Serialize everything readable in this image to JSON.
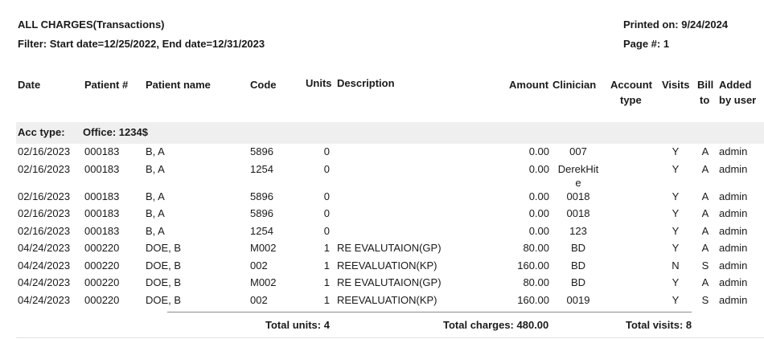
{
  "report": {
    "title": "ALL CHARGES(Transactions)",
    "filter": "Filter: Start date=12/25/2022, End date=12/31/2023",
    "printed_on": "Printed on: 9/24/2024",
    "page": "Page #: 1"
  },
  "columns": {
    "date": "Date",
    "patient_num": "Patient #",
    "patient_name": "Patient name",
    "code": "Code",
    "units": "Units",
    "description": "Description",
    "amount": "Amount",
    "clinician": "Clinician",
    "account_type_1": "Account",
    "account_type_2": "type",
    "visits": "Visits",
    "bill_to_1": "Bill",
    "bill_to_2": "to",
    "added_by_1": "Added",
    "added_by_2": "by user"
  },
  "group": {
    "acc_type_label": "Acc type:",
    "acc_type_value": "Office: 1234$"
  },
  "rows": [
    {
      "date": "02/16/2023",
      "patient_num": "000183",
      "patient_name": "B, A",
      "code": "5896",
      "units": "0",
      "description": "",
      "amount": "0.00",
      "clinician": "007",
      "clinician2": "",
      "visits": "Y",
      "bill_to": "A",
      "added_by": "admin"
    },
    {
      "date": "02/16/2023",
      "patient_num": "000183",
      "patient_name": "B, A",
      "code": "1254",
      "units": "0",
      "description": "",
      "amount": "0.00",
      "clinician": "DerekHit",
      "clinician2": "e",
      "visits": "Y",
      "bill_to": "A",
      "added_by": "admin"
    },
    {
      "date": "02/16/2023",
      "patient_num": "000183",
      "patient_name": "B, A",
      "code": "5896",
      "units": "0",
      "description": "",
      "amount": "0.00",
      "clinician": "0018",
      "clinician2": "",
      "visits": "Y",
      "bill_to": "A",
      "added_by": "admin"
    },
    {
      "date": "02/16/2023",
      "patient_num": "000183",
      "patient_name": "B, A",
      "code": "5896",
      "units": "0",
      "description": "",
      "amount": "0.00",
      "clinician": "0018",
      "clinician2": "",
      "visits": "Y",
      "bill_to": "A",
      "added_by": "admin"
    },
    {
      "date": "02/16/2023",
      "patient_num": "000183",
      "patient_name": "B, A",
      "code": "1254",
      "units": "0",
      "description": "",
      "amount": "0.00",
      "clinician": "123",
      "clinician2": "",
      "visits": "Y",
      "bill_to": "A",
      "added_by": "admin"
    },
    {
      "date": "04/24/2023",
      "patient_num": "000220",
      "patient_name": "DOE, B",
      "code": "M002",
      "units": "1",
      "description": "RE EVALUTAION(GP)",
      "amount": "80.00",
      "clinician": "BD",
      "clinician2": "",
      "visits": "Y",
      "bill_to": "A",
      "added_by": "admin"
    },
    {
      "date": "04/24/2023",
      "patient_num": "000220",
      "patient_name": "DOE, B",
      "code": "002",
      "units": "1",
      "description": "REEVALUATION(KP)",
      "amount": "160.00",
      "clinician": "BD",
      "clinician2": "",
      "visits": "N",
      "bill_to": "S",
      "added_by": "admin"
    },
    {
      "date": "04/24/2023",
      "patient_num": "000220",
      "patient_name": "DOE, B",
      "code": "M002",
      "units": "1",
      "description": "RE EVALUTAION(GP)",
      "amount": "80.00",
      "clinician": "BD",
      "clinician2": "",
      "visits": "Y",
      "bill_to": "A",
      "added_by": "admin"
    },
    {
      "date": "04/24/2023",
      "patient_num": "000220",
      "patient_name": "DOE, B",
      "code": "002",
      "units": "1",
      "description": "REEVALUATION(KP)",
      "amount": "160.00",
      "clinician": "0019",
      "clinician2": "",
      "visits": "Y",
      "bill_to": "S",
      "added_by": "admin"
    }
  ],
  "totals": {
    "units": "Total units: 4",
    "charges": "Total charges: 480.00",
    "visits": "Total visits: 8"
  }
}
